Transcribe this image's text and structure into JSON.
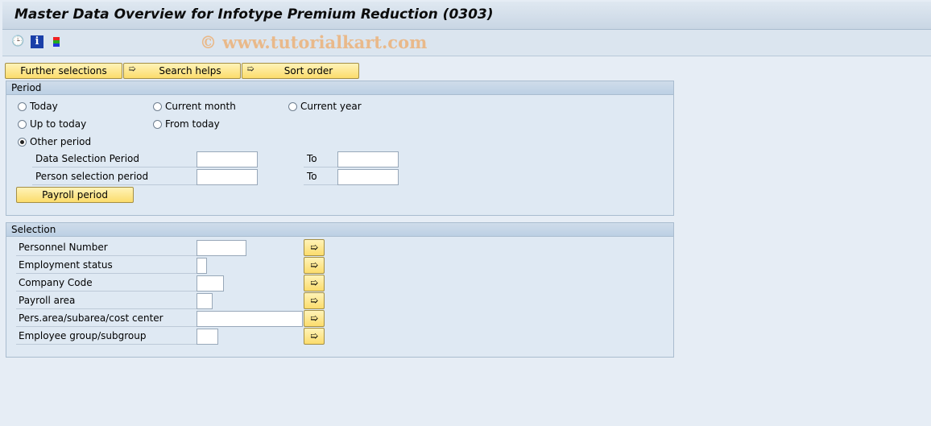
{
  "title": "Master Data Overview for Infotype Premium Reduction (0303)",
  "watermark": "© www.tutorialkart.com",
  "toolbar": {
    "icons": [
      "execute-clock-icon",
      "info-icon",
      "layout-icon"
    ]
  },
  "buttons": {
    "further": "Further selections",
    "search": "Search helps",
    "sort": "Sort order",
    "payroll": "Payroll period"
  },
  "period": {
    "header": "Period",
    "radios": [
      {
        "label": "Today",
        "selected": false
      },
      {
        "label": "Current month",
        "selected": false
      },
      {
        "label": "Current year",
        "selected": false
      },
      {
        "label": "Up to today",
        "selected": false
      },
      {
        "label": "From today",
        "selected": false
      },
      {
        "label": "Other period",
        "selected": true
      }
    ],
    "data_sel": "Data Selection Period",
    "person_sel": "Person selection period",
    "to": "To"
  },
  "selection": {
    "header": "Selection",
    "rows": [
      {
        "label": "Personnel Number",
        "value": ""
      },
      {
        "label": "Employment status",
        "value": ""
      },
      {
        "label": "Company Code",
        "value": ""
      },
      {
        "label": "Payroll area",
        "value": ""
      },
      {
        "label": "Pers.area/subarea/cost center",
        "value": ""
      },
      {
        "label": "Employee group/subgroup",
        "value": ""
      }
    ]
  }
}
